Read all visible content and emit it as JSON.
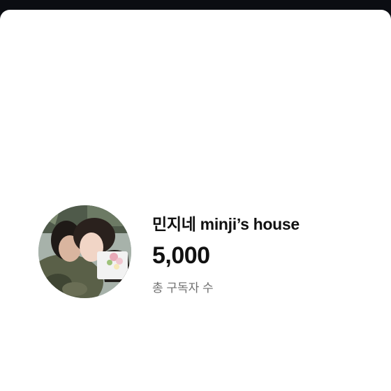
{
  "profile": {
    "avatar_icon": "profile-photo",
    "channel_name": "민지네 minji’s house",
    "subscriber_count": "5,000",
    "subscriber_label": "총 구독자 수"
  },
  "colors": {
    "background": "#ffffff",
    "top_strip": "#0b0d12",
    "primary_text": "#111111",
    "secondary_text": "#6f6f6f"
  }
}
